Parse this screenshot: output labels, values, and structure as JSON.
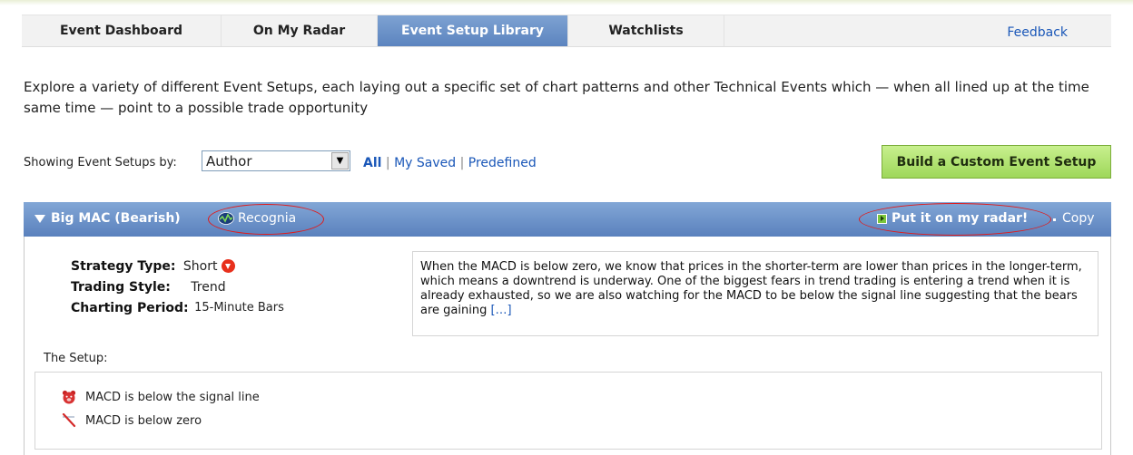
{
  "tabs": [
    {
      "label": "Event Dashboard",
      "active": false
    },
    {
      "label": "On My Radar",
      "active": false
    },
    {
      "label": "Event Setup Library",
      "active": true
    },
    {
      "label": "Watchlists",
      "active": false
    }
  ],
  "feedback_label": "Feedback",
  "intro_text": "Explore a variety of different Event Setups, each laying out a specific set of chart patterns and other Technical Events which — when all lined up at the time same time — point to a possible trade opportunity",
  "filter": {
    "label": "Showing Event Setups by:",
    "selected": "Author",
    "links": {
      "all": "All",
      "sep": "|",
      "my_saved": "My Saved",
      "predefined": "Predefined"
    }
  },
  "build_button": "Build a Custom Event Setup",
  "setup": {
    "title": "Big MAC (Bearish)",
    "author": "Recognia",
    "radar_label": "Put it on my radar!",
    "copy_label": "Copy",
    "properties": [
      {
        "key": "Strategy Type:",
        "value": "Short"
      },
      {
        "key": "Trading Style:",
        "value": "Trend"
      },
      {
        "key": "Charting Period:",
        "value": "15-Minute Bars"
      }
    ],
    "description": "When the MACD is below zero, we know that prices in the shorter-term are lower than prices in the longer-term, which means a downtrend is underway. One of the biggest fears in trend trading is entering a trend when it is already exhausted, so we are also watching for the MACD to be below the signal line suggesting that the bears are gaining",
    "more_label": "[…]",
    "setup_label": "The Setup:",
    "rules": [
      {
        "text": "MACD is below the signal line",
        "icon": "bear-icon"
      },
      {
        "text": "MACD is below zero",
        "icon": "below-zero-icon"
      }
    ]
  },
  "colors": {
    "tab_active": "#6a8fc8",
    "header": "#6a8fc8",
    "build_button": "#b4e374",
    "link": "#1a57b8",
    "highlight": "#e01b1b"
  }
}
